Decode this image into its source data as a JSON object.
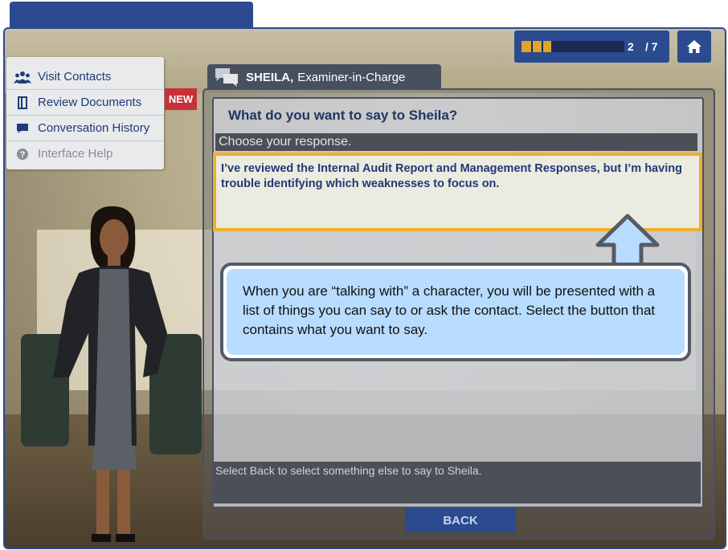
{
  "progress": {
    "current": "2",
    "total": "/ 7",
    "fraction": 0.2857
  },
  "menu": {
    "items": [
      {
        "label": "Visit Contacts",
        "icon": "people-icon"
      },
      {
        "label": "Review Documents",
        "icon": "document-icon"
      },
      {
        "label": "Conversation History",
        "icon": "chat-icon"
      },
      {
        "label": "Interface Help",
        "icon": "help-icon"
      }
    ],
    "badge": "NEW"
  },
  "character": {
    "name": "SHEILA,",
    "role": "Examiner-in-Charge"
  },
  "dialog": {
    "question": "What do you want to say to Sheila?",
    "choose_prompt": "Choose your response.",
    "response": "I’ve reviewed the Internal Audit Report and Management Responses, but I’m having trouble identifying which weaknesses to focus on.",
    "instruction": "Select Back to select something else to say to Sheila.",
    "back_label": "BACK"
  },
  "callout": {
    "text": "When you are “talking with” a character, you will be presented with a list of things you can say to or ask the contact. Select the button that contains what you want to say."
  },
  "colors": {
    "brand": "#2b4a8f",
    "highlight": "#f0b02c",
    "badge": "#c8303a",
    "callout": "#b8dcff"
  }
}
